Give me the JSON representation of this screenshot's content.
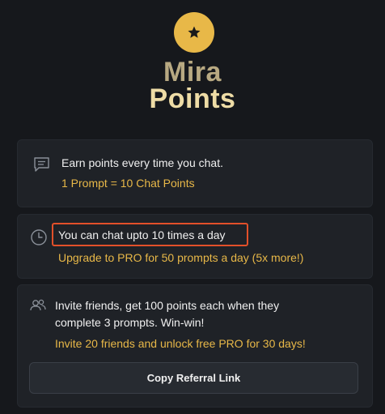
{
  "app": {
    "title_line1": "Mira",
    "title_line2": "Points",
    "logo_icon": "star-icon",
    "accent_color": "#e8b848",
    "highlight_color": "#e2502a"
  },
  "cards": [
    {
      "icon": "chat-icon",
      "text": "Earn points every time you chat.",
      "detail": "1 Prompt = 10 Chat Points"
    },
    {
      "icon": "clock-icon",
      "text": "You can chat upto 10 times a day",
      "detail": "Upgrade to PRO for 50 prompts a day (5x more!)"
    },
    {
      "icon": "users-icon",
      "text_line1": "Invite friends, get 100 points each when they",
      "text_line2": "complete 3 prompts. Win-win!",
      "detail": "Invite 20 friends and unlock free PRO for 30 days!",
      "button_label": "Copy Referral Link"
    }
  ]
}
